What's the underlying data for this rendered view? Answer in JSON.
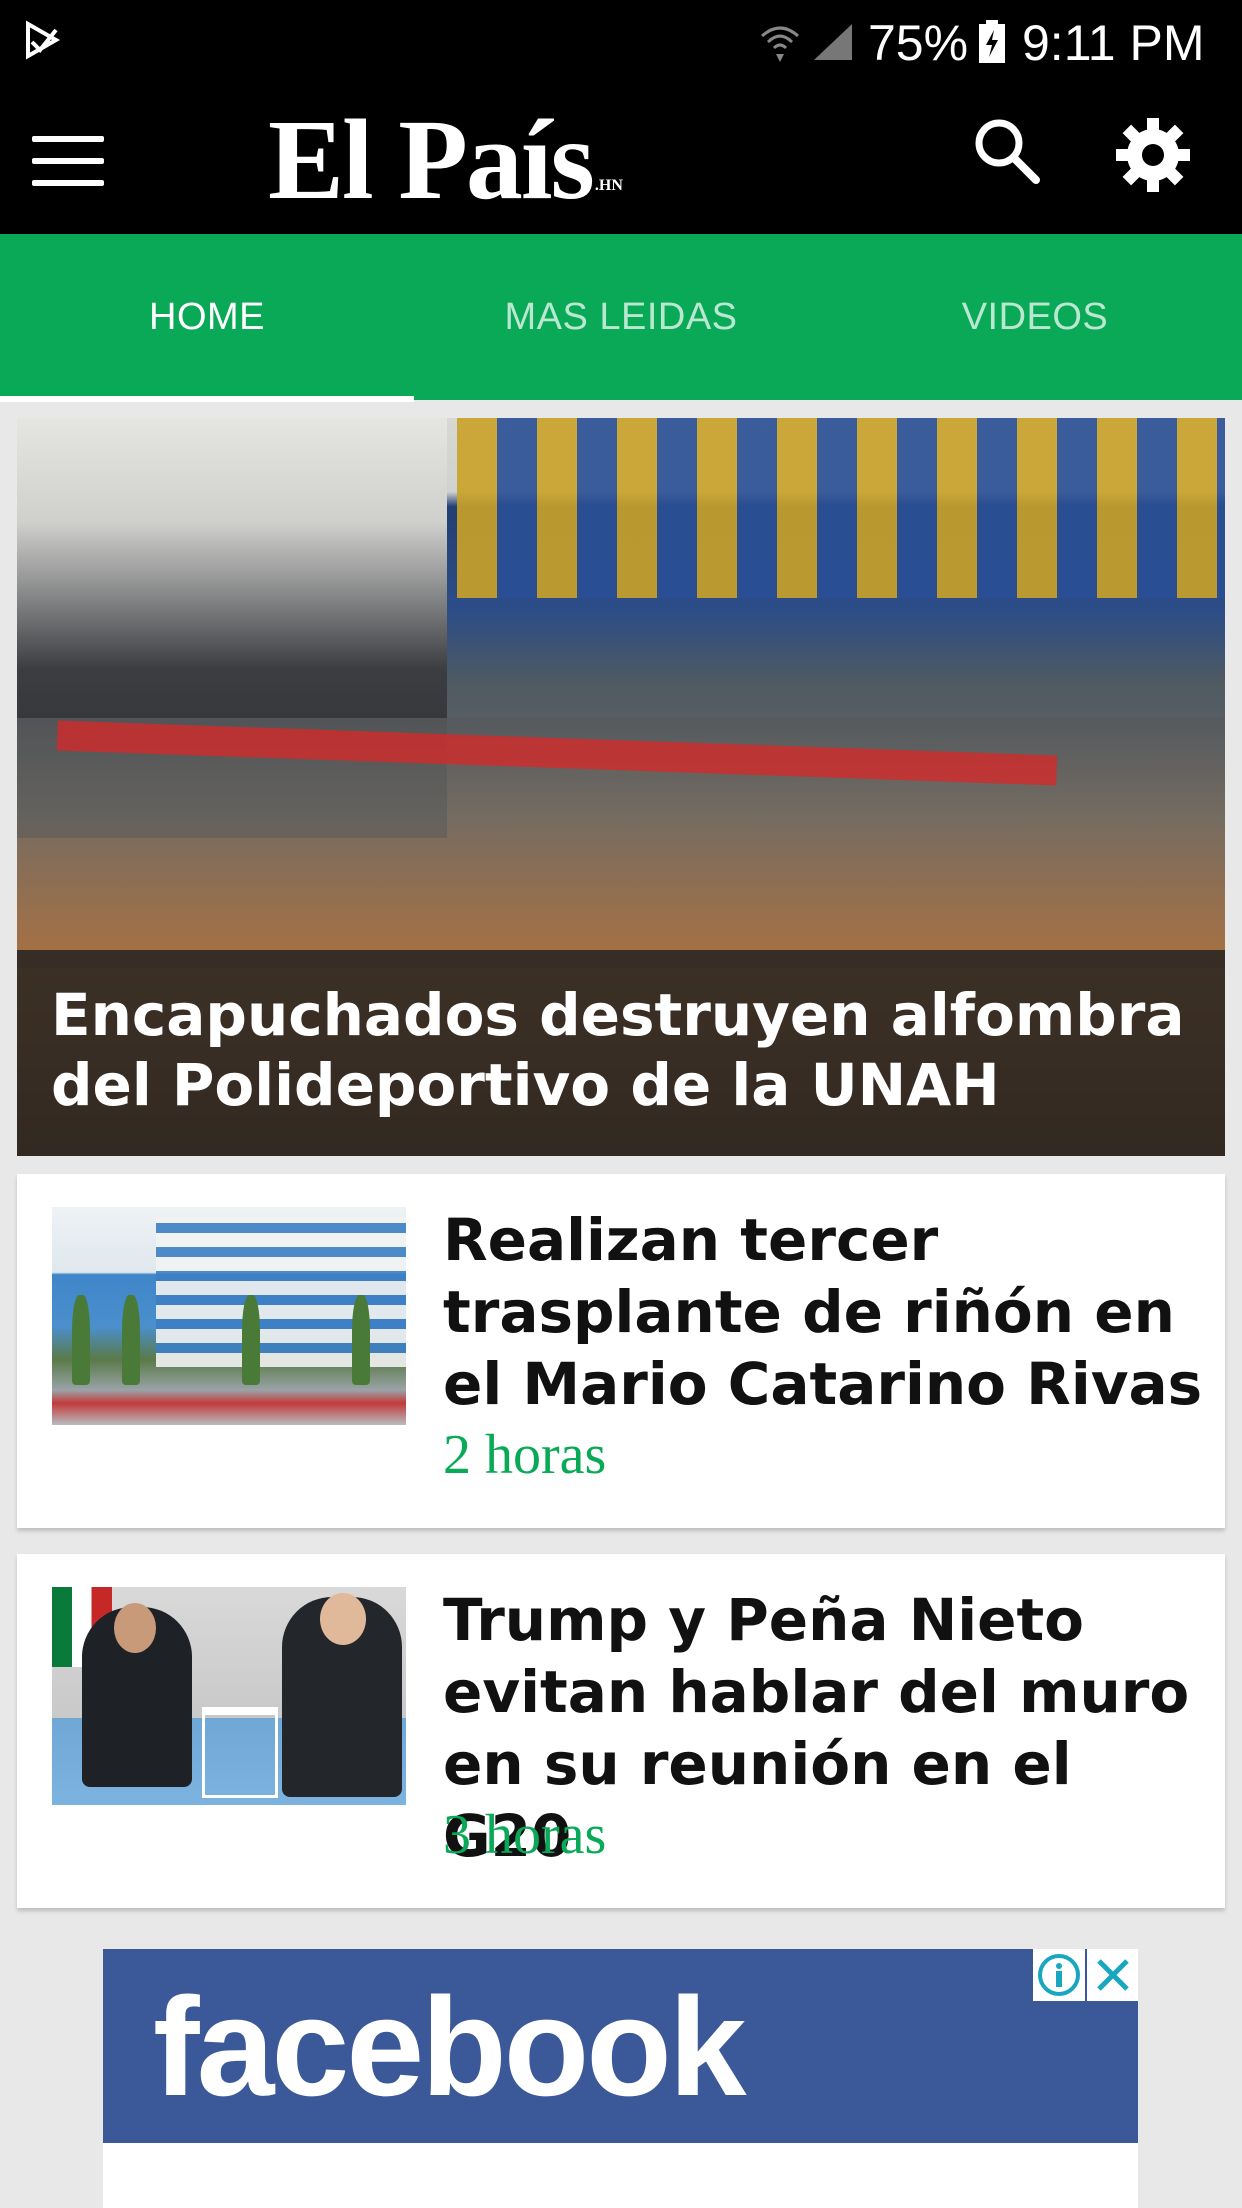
{
  "status_bar": {
    "battery_percent": "75%",
    "time": "9:11 PM",
    "icons": [
      "play-store-icon",
      "wifi-icon",
      "signal-icon",
      "battery-charging-icon"
    ]
  },
  "app_bar": {
    "logo_text": "El País",
    "logo_suffix": ".HN",
    "icons": [
      "menu-icon",
      "search-icon",
      "gear-icon"
    ]
  },
  "tabs": [
    {
      "label": "HOME",
      "active": true
    },
    {
      "label": "MAS LEIDAS",
      "active": false
    },
    {
      "label": "VIDEOS",
      "active": false
    }
  ],
  "colors": {
    "accent_green": "#0aa957",
    "app_bar_bg": "#000000",
    "facebook_blue": "#3b5998",
    "ad_icon_teal": "#19a7c0"
  },
  "hero": {
    "title": "Encapuchados destruyen alfombra del Polideportivo de la UNAH"
  },
  "articles": [
    {
      "title": "Realizan tercer trasplante de riñón en el Mario Catarino Rivas",
      "time": "2 horas"
    },
    {
      "title": "Trump y Peña Nieto evitan hablar del muro en su reunión en el G20",
      "time": "3 horas"
    }
  ],
  "ad": {
    "brand": "facebook",
    "icons": [
      "ad-info-icon",
      "ad-close-icon"
    ]
  }
}
